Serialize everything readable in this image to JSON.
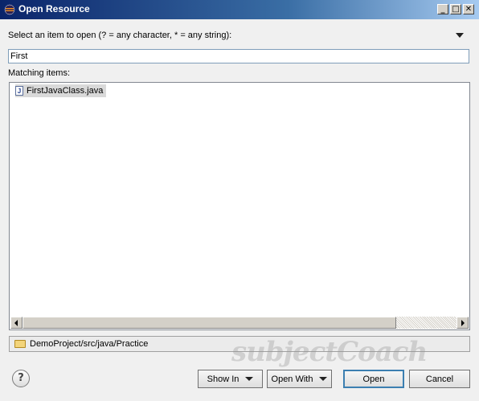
{
  "window": {
    "title": "Open Resource",
    "controls": {
      "minimize": "_",
      "maximize": "□",
      "close": "✕"
    }
  },
  "dialog": {
    "prompt": "Select an item to open (? = any character, * = any string):",
    "search": {
      "value": "First",
      "placeholder": ""
    },
    "matching_label": "Matching items:",
    "items": [
      {
        "label": "FirstJavaClass.java",
        "icon": "java-file-icon"
      }
    ],
    "status_path": "DemoProject/src/java/Practice",
    "watermark": "subjectCoach"
  },
  "buttons": {
    "help": "?",
    "show_in": "Show In",
    "open_with": "Open With",
    "open": "Open",
    "cancel": "Cancel"
  }
}
